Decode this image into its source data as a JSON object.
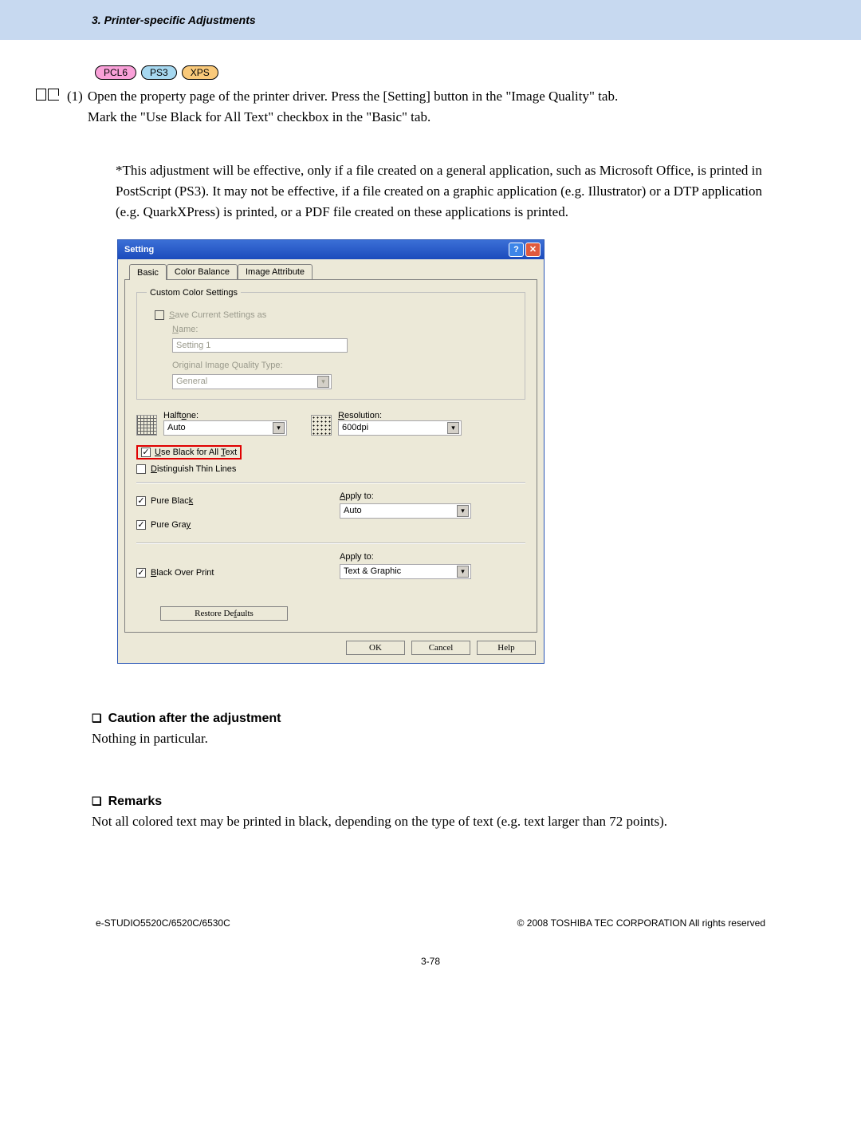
{
  "header": {
    "title": "3. Printer-specific Adjustments"
  },
  "pills": {
    "pcl6": "PCL6",
    "ps3": "PS3",
    "xps": "XPS"
  },
  "step": {
    "num": "(1)",
    "line1": "Open the property page of the printer driver.  Press the [Setting] button in the \"Image Quality\" tab.",
    "line2": "Mark the \"Use Black for All Text\" checkbox in the \"Basic\" tab."
  },
  "note": {
    "star": "*",
    "text": "This adjustment will be effective, only if a file created on a general application, such as Microsoft Office, is printed in PostScript (PS3).  It may not be effective, if a file created on a graphic application (e.g. Illustrator) or a DTP application (e.g. QuarkXPress) is printed, or a PDF file created on these applications is printed."
  },
  "dialog": {
    "title": "Setting",
    "tabs": {
      "basic": "Basic",
      "colorbalance": "Color Balance",
      "imageattr": "Image Attribute"
    },
    "ccs": {
      "legend": "Custom Color Settings",
      "savecb_prefix": "S",
      "savecb_rest": "ave Current Settings as",
      "name_prefix": "N",
      "name_rest": "ame:",
      "namefield": "Setting 1",
      "origlabel": "Original Image Quality Type:",
      "origvalue": "General"
    },
    "halftone_prefix": "Halft",
    "halftone_u": "o",
    "halftone_rest": "ne:",
    "halftone_value": "Auto",
    "resolution_prefix": "R",
    "resolution_rest": "esolution:",
    "resolution_value": "600dpi",
    "useblack_prefix": "U",
    "useblack_mid": "se Black for All ",
    "useblack_u2": "T",
    "useblack_end": "ext",
    "distinguish_prefix": "D",
    "distinguish_rest": "istinguish Thin Lines",
    "pureblack_pre": "Pure Blac",
    "pureblack_u": "k",
    "puregray_pre": "Pure Gra",
    "puregray_u": "y",
    "applyto_prefix": "A",
    "applyto_rest": "pply to:",
    "applyto1_value": "Auto",
    "applyto2_label": "Apply to:",
    "applyto2_value": "Text & Graphic",
    "bop_prefix": "B",
    "bop_rest": "lack Over Print",
    "restore_pre": "Restore De",
    "restore_u": "f",
    "restore_post": "aults",
    "ok": "OK",
    "cancel": "Cancel",
    "help": "Help"
  },
  "caution": {
    "head": "Caution after the adjustment",
    "body": "Nothing in particular."
  },
  "remarks": {
    "head": "Remarks",
    "body": "Not all colored text may be printed in black, depending on the type of text (e.g. text larger than 72 points)."
  },
  "footer": {
    "left": "e-STUDIO5520C/6520C/6530C",
    "right": "© 2008 TOSHIBA TEC CORPORATION All rights reserved",
    "page": "3-78"
  }
}
